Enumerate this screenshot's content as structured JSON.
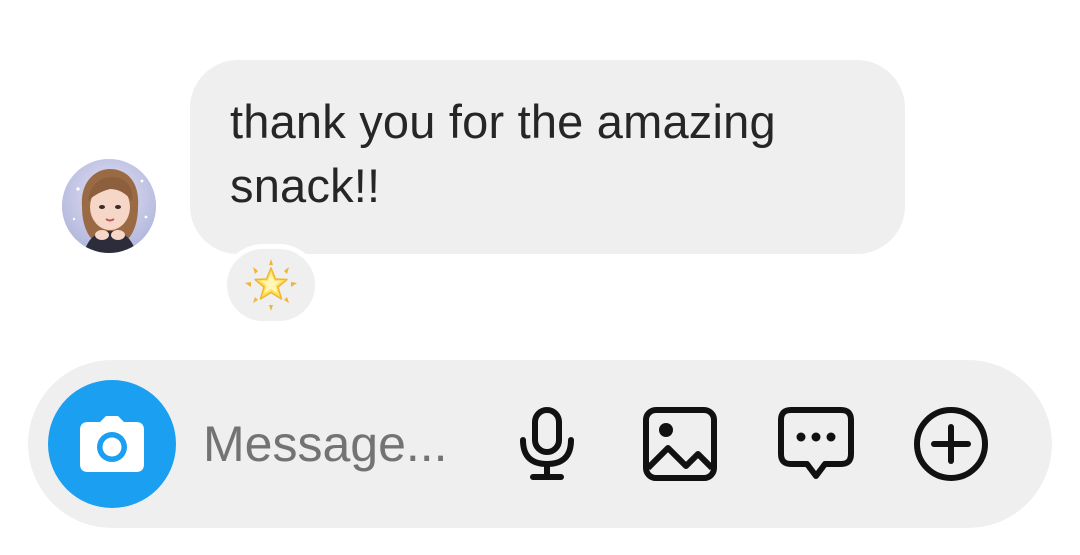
{
  "message": {
    "text": "thank you for the amazing\nsnack!!",
    "reaction_emoji": "glowing-star"
  },
  "composer": {
    "placeholder": "Message...",
    "icons": [
      "camera-icon",
      "microphone-icon",
      "gallery-icon",
      "chat-bubble-icon",
      "plus-circle-icon"
    ]
  },
  "colors": {
    "bubble_bg": "#efefef",
    "camera_bg": "#1a9ff1",
    "text": "#262626",
    "placeholder": "#737373"
  }
}
